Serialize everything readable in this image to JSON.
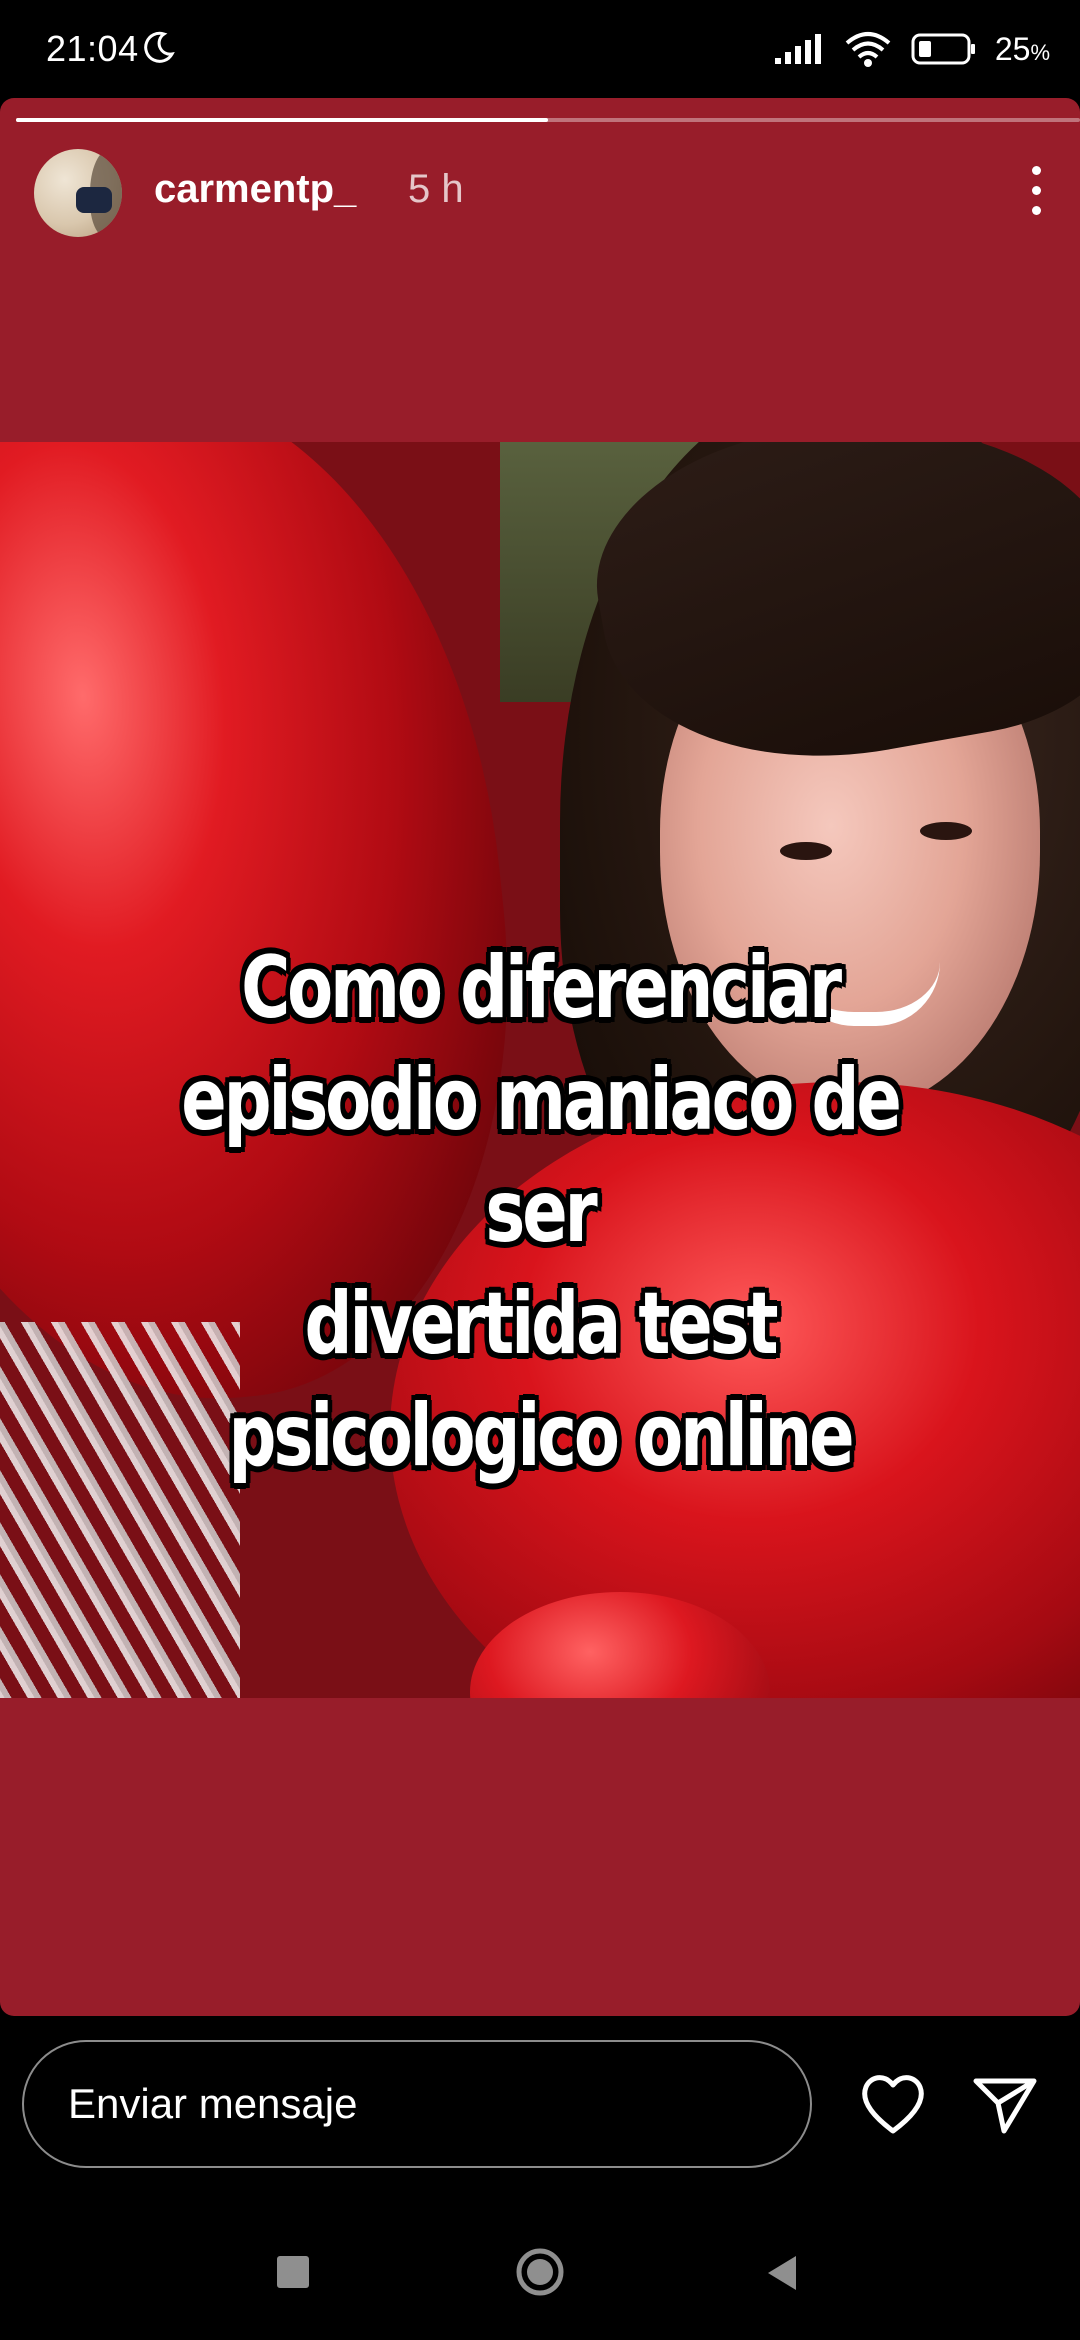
{
  "status_bar": {
    "time": "21:04",
    "battery": "25",
    "battery_unit": "%",
    "icons": [
      "moon-icon",
      "signal-icon",
      "wifi-icon",
      "battery-icon"
    ]
  },
  "story": {
    "progress": 0.5,
    "username": "carmentp_",
    "time_ago": "5 h",
    "background_color": "#981d2a",
    "caption": "Como diferenciar\nepisodio maniaco de ser\ndivertida   test\npsicologico online"
  },
  "reply": {
    "placeholder": "Enviar mensaje",
    "icons": [
      "heart-icon",
      "send-icon"
    ]
  },
  "nav_bar": {
    "icons": [
      "recents-icon",
      "home-icon",
      "back-icon"
    ]
  }
}
